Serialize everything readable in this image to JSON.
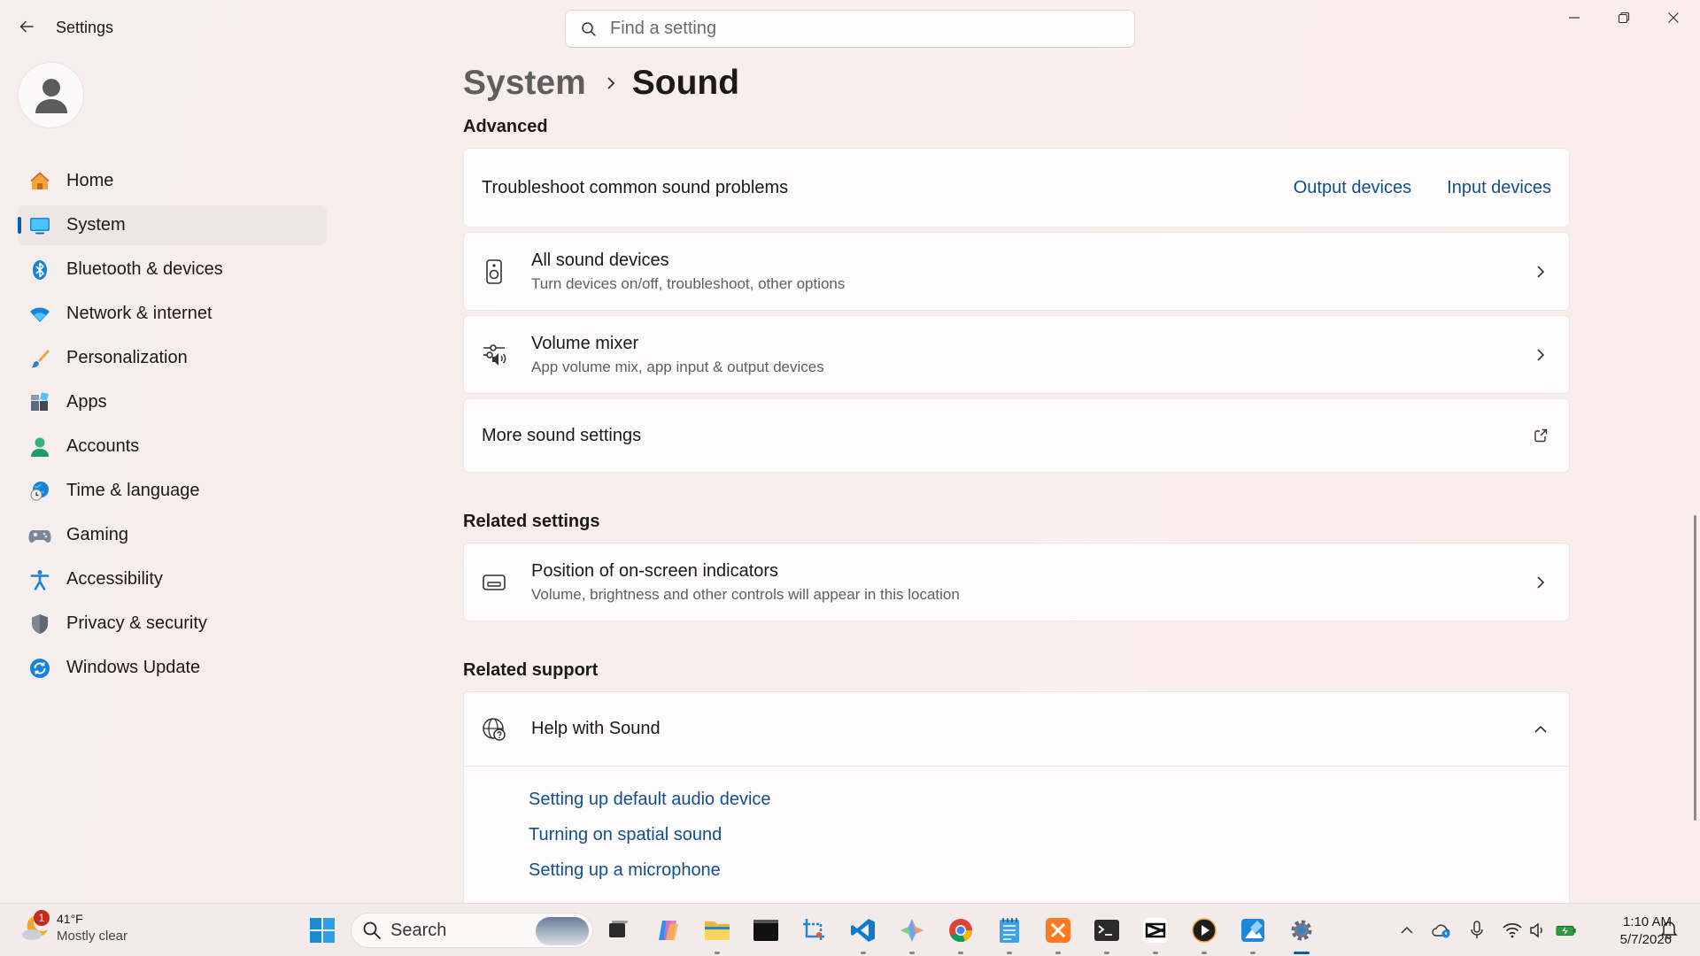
{
  "window": {
    "app_title": "Settings",
    "search_placeholder": "Find a setting"
  },
  "sidebar": {
    "items": [
      {
        "label": "Home",
        "icon": "home-icon"
      },
      {
        "label": "System",
        "icon": "system-icon",
        "active": true
      },
      {
        "label": "Bluetooth & devices",
        "icon": "bluetooth-icon"
      },
      {
        "label": "Network & internet",
        "icon": "wifi-icon"
      },
      {
        "label": "Personalization",
        "icon": "brush-icon"
      },
      {
        "label": "Apps",
        "icon": "apps-icon"
      },
      {
        "label": "Accounts",
        "icon": "accounts-icon"
      },
      {
        "label": "Time & language",
        "icon": "globe-clock-icon"
      },
      {
        "label": "Gaming",
        "icon": "gamepad-icon"
      },
      {
        "label": "Accessibility",
        "icon": "accessibility-icon"
      },
      {
        "label": "Privacy & security",
        "icon": "shield-icon"
      },
      {
        "label": "Windows Update",
        "icon": "update-icon"
      }
    ]
  },
  "breadcrumb": {
    "parent": "System",
    "current": "Sound"
  },
  "advanced": {
    "heading": "Advanced",
    "troubleshoot": {
      "label": "Troubleshoot common sound problems",
      "link_output": "Output devices",
      "link_input": "Input devices"
    },
    "all_devices": {
      "title": "All sound devices",
      "subtitle": "Turn devices on/off, troubleshoot, other options"
    },
    "volume_mixer": {
      "title": "Volume mixer",
      "subtitle": "App volume mix, app input & output devices"
    },
    "more_settings": {
      "title": "More sound settings"
    }
  },
  "related_settings": {
    "heading": "Related settings",
    "position_indicators": {
      "title": "Position of on-screen indicators",
      "subtitle": "Volume, brightness and other controls will appear in this location"
    }
  },
  "related_support": {
    "heading": "Related support",
    "help": {
      "title": "Help with Sound",
      "links": [
        "Setting up default audio device",
        "Turning on spatial sound",
        "Setting up a microphone"
      ]
    }
  },
  "taskbar": {
    "weather_temp": "41°F",
    "weather_desc": "Mostly clear",
    "weather_badge": "1",
    "search_label": "Search",
    "time": "1:10 AM",
    "date": "5/7/2026"
  },
  "colors": {
    "accent": "#005fb8",
    "link": "#0f4f8f"
  }
}
